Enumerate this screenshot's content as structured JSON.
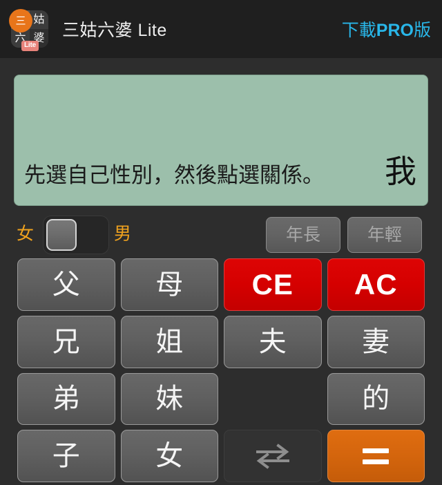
{
  "header": {
    "app_icon": {
      "name": "app-icon",
      "cells": [
        "三",
        "姑",
        "六",
        "婆"
      ],
      "circle_char": "三",
      "badge": "Lite",
      "circle_color": "#e8751a",
      "badge_color": "#e8837b"
    },
    "title": "三姑六婆 Lite",
    "pro_link": {
      "prefix": "下載",
      "emphasis": "PRO",
      "suffix": "版",
      "full": "下載PRO版",
      "color": "#29b6e8"
    },
    "background": "#1f1f1f"
  },
  "display": {
    "expression": "先選自己性別，然後點選關係。",
    "result": "我",
    "background": "#9cbfab",
    "text_color": "#1a1a1a"
  },
  "controls": {
    "gender": {
      "female_label": "女",
      "male_label": "男",
      "selected": "女",
      "label_color": "#f0a21e"
    },
    "age_buttons": [
      {
        "name": "elder-button",
        "label": "年長",
        "enabled": false
      },
      {
        "name": "younger-button",
        "label": "年輕",
        "enabled": false
      }
    ]
  },
  "keypad": {
    "keys": [
      {
        "name": "key-father",
        "label": "父",
        "style": "normal",
        "icon": null
      },
      {
        "name": "key-mother",
        "label": "母",
        "style": "normal",
        "icon": null
      },
      {
        "name": "key-ce",
        "label": "CE",
        "style": "red",
        "icon": null
      },
      {
        "name": "key-ac",
        "label": "AC",
        "style": "red",
        "icon": null
      },
      {
        "name": "key-elder-brother",
        "label": "兄",
        "style": "normal",
        "icon": null
      },
      {
        "name": "key-elder-sister",
        "label": "姐",
        "style": "normal",
        "icon": null
      },
      {
        "name": "key-husband",
        "label": "夫",
        "style": "normal",
        "icon": null
      },
      {
        "name": "key-wife",
        "label": "妻",
        "style": "normal",
        "icon": null
      },
      {
        "name": "key-younger-brother",
        "label": "弟",
        "style": "normal",
        "icon": null
      },
      {
        "name": "key-younger-sister",
        "label": "妹",
        "style": "normal",
        "icon": null
      },
      {
        "name": "key-blank",
        "label": "",
        "style": "empty",
        "icon": null
      },
      {
        "name": "key-possessive-de",
        "label": "的",
        "style": "normal",
        "icon": null
      },
      {
        "name": "key-son",
        "label": "子",
        "style": "normal",
        "icon": null
      },
      {
        "name": "key-daughter",
        "label": "女",
        "style": "normal",
        "icon": null
      },
      {
        "name": "key-swap",
        "label": "",
        "style": "dark",
        "icon": "swap-arrows-icon"
      },
      {
        "name": "key-equals",
        "label": "=",
        "style": "orange",
        "icon": "equals-icon"
      }
    ],
    "colors": {
      "normal": "#606060",
      "red": "#d40000",
      "orange": "#d4650d",
      "dark": "#323232"
    }
  },
  "page": {
    "background": "#2d2d2d"
  }
}
